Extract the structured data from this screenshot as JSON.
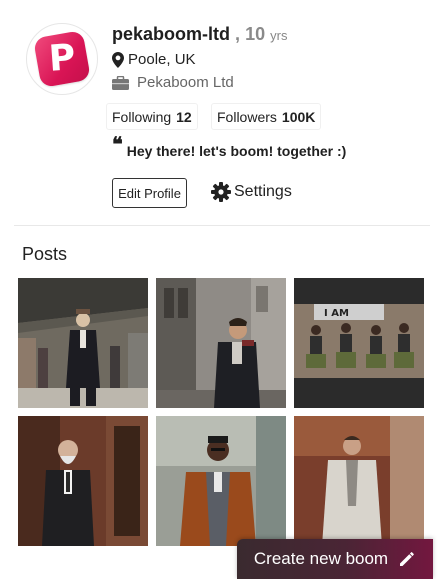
{
  "profile": {
    "username": "pekaboom-ltd",
    "age_separator": ",",
    "age": "10",
    "age_unit": "yrs",
    "location": "Poole, UK",
    "company": "Pekaboom Ltd",
    "avatar_letter": "P",
    "bio": "Hey there! let's boom! together :)"
  },
  "stats": {
    "following_label": "Following",
    "following_count": "12",
    "followers_label": "Followers",
    "followers_count": "100K"
  },
  "actions": {
    "edit_profile": "Edit Profile",
    "settings": "Settings",
    "create": "Create new boom"
  },
  "posts": {
    "title": "Posts",
    "items": [
      "station-portrait",
      "street-coat-portrait",
      "dance-group",
      "suit-doorway-portrait",
      "brown-coat-portrait",
      "grey-coat-portrait"
    ]
  },
  "colors": {
    "brand_pink": "#d91455",
    "fab_dark": "#3a2a2f",
    "fab_accent": "#73173f"
  }
}
